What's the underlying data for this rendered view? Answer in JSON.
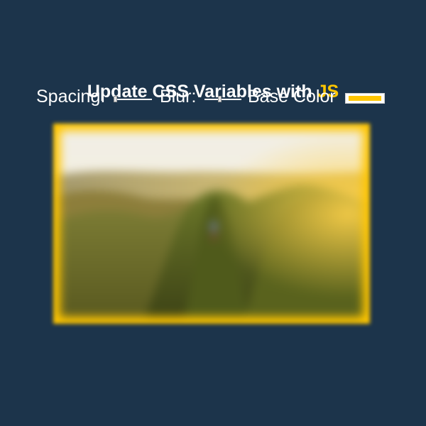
{
  "header": {
    "title_prefix": "Update CSS Variables with ",
    "title_highlight": "JS"
  },
  "controls": {
    "spacing_label": "Spacing:",
    "spacing_value": 0,
    "blur_label": "Blur:",
    "blur_value": 0.4,
    "base_color_label": "Base Color",
    "base_color_value": "#ffc600"
  },
  "image": {
    "name": "hiker-on-mountain-ridge"
  },
  "colors": {
    "background": "#1c344b",
    "accent": "#ffc600",
    "text": "#ffffff"
  }
}
